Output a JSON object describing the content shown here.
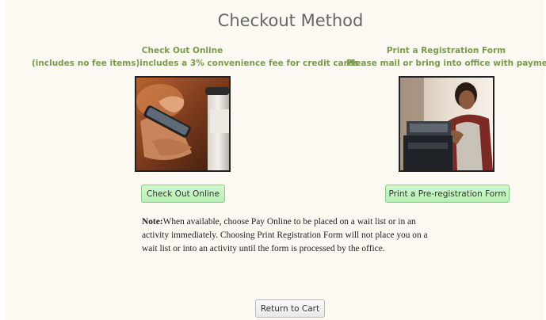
{
  "page": {
    "title": "Checkout Method"
  },
  "online": {
    "heading": "Check Out Online",
    "subheading": "(includes no fee items)includes a 3% convenience fee for credit cards",
    "button_label": "Check Out Online",
    "image_alt": "photo-hand-holding-phone-and-coffee"
  },
  "print_form": {
    "heading": "Print a Registration Form",
    "subheading": "Please mail or bring into office with payment.",
    "button_label": "Print a Pre-registration Form",
    "image_alt": "photo-woman-at-cash-register"
  },
  "note": {
    "label": "Note:",
    "text": "When available, choose Pay Online to be placed on a wait list or in an activity immediately. Choosing Print Registration Form will not place you on a wait list or into an activity until the form is processed by the office."
  },
  "footer": {
    "return_label": "Return to Cart"
  },
  "colors": {
    "heading_green": "#7a9a4c",
    "button_green": "#c4f4c0",
    "panel_bg": "#fcf9f3"
  }
}
